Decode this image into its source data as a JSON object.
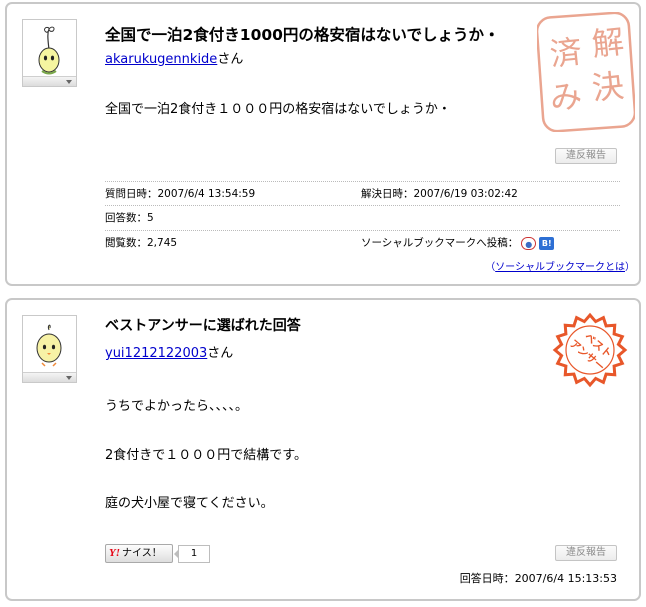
{
  "question": {
    "title": "全国で一泊2食付き1000円の格安宿はないでしょうか・",
    "username": "akarukugennkide",
    "user_suffix": "さん",
    "body": "全国で一泊2食付き１０００円の格安宿はないでしょうか・",
    "report_label": "違反報告",
    "asked_label": "質問日時：",
    "asked_value": "2007/6/4 13:54:59",
    "resolved_label": "解決日時：",
    "resolved_value": "2007/6/19 03:02:42",
    "answers_label": "回答数：",
    "answers_value": "5",
    "views_label": "閲覧数：",
    "views_value": "2,745",
    "social_label": "ソーシャルブックマークへ投稿：",
    "sbm_open": "（",
    "sbm_link": "ソーシャルブックマークとは",
    "sbm_close": "）",
    "resolved_stamp": [
      "解",
      "決",
      "済",
      "み"
    ]
  },
  "best_answer": {
    "title": "ベストアンサーに選ばれた回答",
    "username": "yui1212122003",
    "user_suffix": "さん",
    "lines": [
      "うちでよかったら、、、、。",
      "2食付きで１０００円で結構です。",
      "庭の犬小屋で寝てください。"
    ],
    "stamp_text": [
      "ベスト",
      "アンサー"
    ],
    "nice_label": "ナイス！",
    "nice_logo": "Y!",
    "nice_count": "1",
    "report_label": "違反報告",
    "answered_label": "回答日時：",
    "answered_value": "2007/6/4 15:13:53"
  },
  "colors": {
    "stamp_red": "#e8572a",
    "resolved_stamp_red": "#eaa590",
    "border": "#c8c8c8",
    "link": "#0000cc"
  },
  "icons": {
    "social_1": "bookmark-icon",
    "social_2": "hatena-b-icon"
  }
}
